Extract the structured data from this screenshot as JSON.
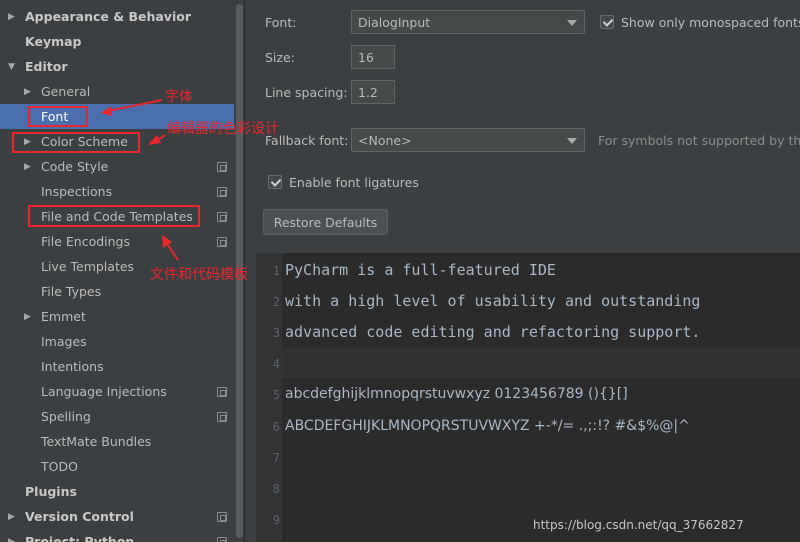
{
  "sidebar": {
    "items": [
      {
        "label": "Appearance & Behavior",
        "level": 0,
        "bold": true,
        "arrow": "▶"
      },
      {
        "label": "Keymap",
        "level": 0,
        "bold": true,
        "arrow": ""
      },
      {
        "label": "Editor",
        "level": 0,
        "bold": true,
        "arrow": "▼"
      },
      {
        "label": "General",
        "level": 1,
        "arrow": "▶"
      },
      {
        "label": "Font",
        "level": 1,
        "arrow": "",
        "selected": true
      },
      {
        "label": "Color Scheme",
        "level": 1,
        "arrow": "▶"
      },
      {
        "label": "Code Style",
        "level": 1,
        "arrow": "▶",
        "icon": true
      },
      {
        "label": "Inspections",
        "level": 1,
        "arrow": "",
        "icon": true
      },
      {
        "label": "File and Code Templates",
        "level": 1,
        "arrow": "",
        "icon": true
      },
      {
        "label": "File Encodings",
        "level": 1,
        "arrow": "",
        "icon": true
      },
      {
        "label": "Live Templates",
        "level": 1,
        "arrow": ""
      },
      {
        "label": "File Types",
        "level": 1,
        "arrow": ""
      },
      {
        "label": "Emmet",
        "level": 1,
        "arrow": "▶"
      },
      {
        "label": "Images",
        "level": 1,
        "arrow": ""
      },
      {
        "label": "Intentions",
        "level": 1,
        "arrow": ""
      },
      {
        "label": "Language Injections",
        "level": 1,
        "arrow": "",
        "icon": true
      },
      {
        "label": "Spelling",
        "level": 1,
        "arrow": "",
        "icon": true
      },
      {
        "label": "TextMate Bundles",
        "level": 1,
        "arrow": ""
      },
      {
        "label": "TODO",
        "level": 1,
        "arrow": ""
      },
      {
        "label": "Plugins",
        "level": 0,
        "bold": true,
        "arrow": ""
      },
      {
        "label": "Version Control",
        "level": 0,
        "bold": true,
        "arrow": "▶",
        "icon": true
      },
      {
        "label": "Project: Python",
        "level": 0,
        "bold": true,
        "arrow": "▶",
        "icon": true
      }
    ]
  },
  "settings": {
    "font_label": "Font:",
    "font_value": "DialogInput",
    "monospace_label": "Show only monospaced fonts",
    "monospace_checked": true,
    "size_label": "Size:",
    "size_value": "16",
    "line_spacing_label": "Line spacing:",
    "line_spacing_value": "1.2",
    "fallback_label": "Fallback font:",
    "fallback_value": "<None>",
    "fallback_hint": "For symbols not supported by the",
    "ligatures_label": "Enable font ligatures",
    "ligatures_checked": true,
    "restore_label": "Restore Defaults"
  },
  "preview": {
    "lines": [
      {
        "n": "1",
        "text": "PyCharm is a full-featured IDE"
      },
      {
        "n": "2",
        "text": "with a high level of usability and outstanding"
      },
      {
        "n": "3",
        "text": "advanced code editing and refactoring support."
      },
      {
        "n": "4",
        "text": ""
      },
      {
        "n": "5",
        "text": "abcdefghijklmnopqrstuvwxyz 0123456789 (){}[]"
      },
      {
        "n": "6",
        "text": "ABCDEFGHIJKLMNOPQRSTUVWXYZ +-*/= .,;:!? #&$%@|^"
      },
      {
        "n": "7",
        "text": ""
      },
      {
        "n": "8",
        "text": ""
      },
      {
        "n": "9",
        "text": ""
      }
    ]
  },
  "annotations": {
    "font": "字体",
    "color_scheme": "编辑器的色彩设计",
    "templates": "文件和代码模板"
  },
  "watermark": "https://blog.csdn.net/qq_37662827",
  "colors": {
    "background": "#3c3f41",
    "selection": "#4b6eaf",
    "editor_bg": "#2b2b2b",
    "annotation": "#e8262b"
  }
}
